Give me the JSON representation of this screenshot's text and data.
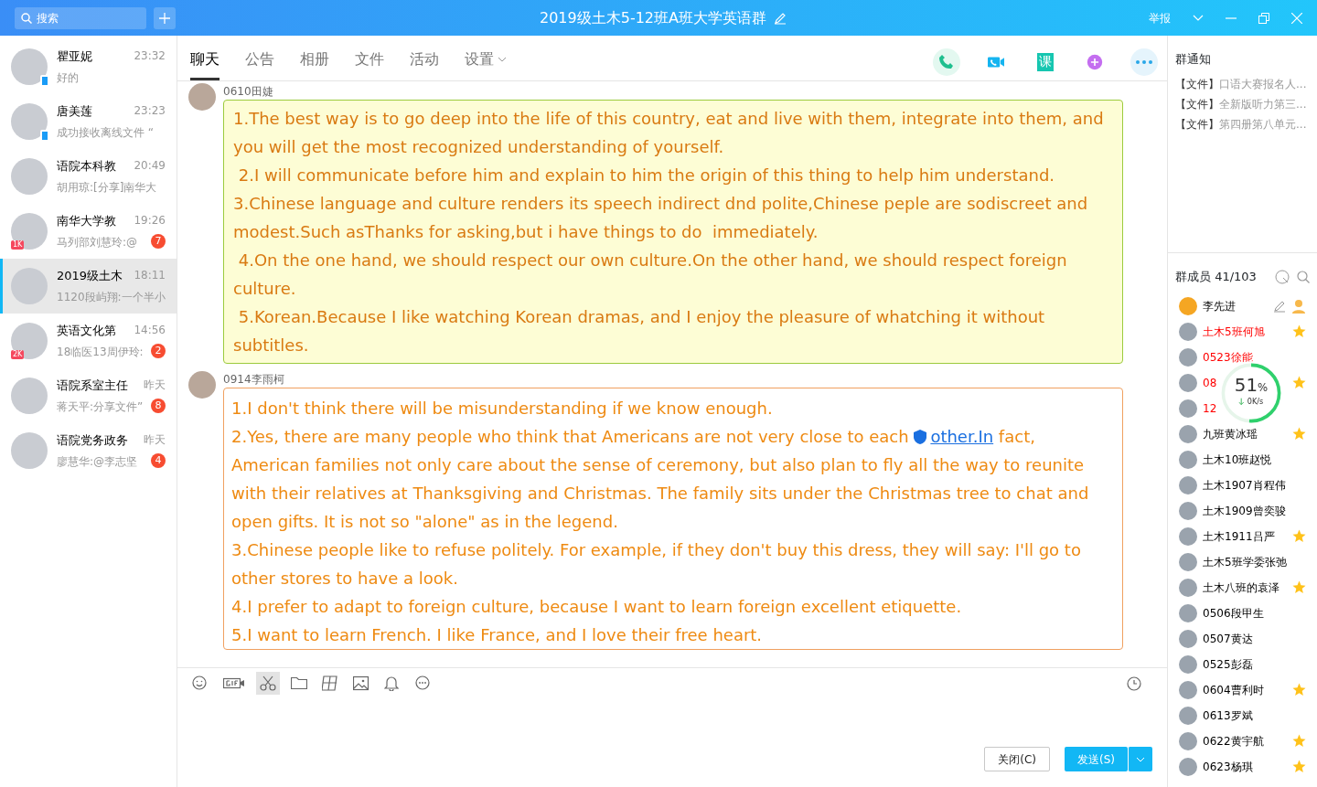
{
  "window": {
    "title": "2019级土木5-12班A班大学英语群",
    "report": "举报"
  },
  "search": {
    "placeholder": "搜索"
  },
  "contacts": [
    {
      "name": "瞿亚妮",
      "time": "23:32",
      "preview": "好的",
      "mobile": true,
      "selected": false
    },
    {
      "name": "唐美莲",
      "time": "23:23",
      "preview": "成功接收离线文件 “",
      "mobile": true,
      "selected": false
    },
    {
      "name": "语院本科教",
      "time": "20:49",
      "preview": "胡用琼:[分享]南华大",
      "mobile": false,
      "selected": false
    },
    {
      "name": "南华大学教",
      "time": "19:26",
      "preview": "马列部刘慧玲:@",
      "mobile": false,
      "selected": false,
      "tag": "1K",
      "unread": "7"
    },
    {
      "name": "2019级土木",
      "time": "18:11",
      "preview": "1120段屿翔:一个半小",
      "mobile": false,
      "selected": true
    },
    {
      "name": "英语文化第",
      "time": "14:56",
      "preview": "18临医13周伊玲:",
      "mobile": false,
      "selected": false,
      "tag": "2K",
      "unread": "2"
    },
    {
      "name": "语院系室主任",
      "time": "昨天",
      "preview": "蒋天平:分享文件”",
      "mobile": false,
      "selected": false,
      "unread": "8"
    },
    {
      "name": "语院党务政务",
      "time": "昨天",
      "preview": "廖慧华:@李志坚",
      "mobile": false,
      "selected": false,
      "unread": "4"
    }
  ],
  "tabs": [
    {
      "label": "聊天",
      "selected": true
    },
    {
      "label": "公告",
      "selected": false
    },
    {
      "label": "相册",
      "selected": false
    },
    {
      "label": "文件",
      "selected": false
    },
    {
      "label": "活动",
      "selected": false
    },
    {
      "label": "设置",
      "selected": false,
      "dropdown": true
    }
  ],
  "messages": [
    {
      "sender": "0610田婕",
      "kind": "note",
      "paragraphs": [
        {
          "text": "1.The best way is to go deep into the life of this country, eat and live with them, integrate into them, and you will get the most recognized understanding of yourself."
        },
        {
          "text": " 2.I will communicate before him and explain to him the origin of this thing to help him understand."
        },
        {
          "text": "3.Chinese language and culture renders its speech indirect dnd polite,Chinese peple are sodiscreet and modest.Such asThanks for asking,but i have things to do  immediately."
        },
        {
          "text": " 4.On the one hand, we should respect our own culture.On the other hand, we should respect foreign culture."
        },
        {
          "text": " 5.Korean.Because I like watching Korean dramas, and I enjoy the pleasure of whatching it without subtitles."
        }
      ]
    },
    {
      "sender": "0914李雨柯",
      "kind": "plain",
      "paragraphs": [
        {
          "text": "1.I don't think there will be misunderstanding if we know enough."
        },
        {
          "text": "2.Yes, there are many people who think that Americans are not very close to each ",
          "link": "other.In",
          "after": " fact, American families not only care about the sense of ceremony, but also plan to fly all the way to reunite with their relatives at Thanksgiving and Christmas. The family sits under the Christmas tree to chat and open gifts. It is not so \"alone\" as in the legend."
        },
        {
          "text": "3.Chinese people like to refuse politely. For example, if they don't buy this dress, they will say: I'll go to other stores to have a look."
        },
        {
          "text": "4.I prefer to adapt to foreign culture, because I want to learn foreign excellent etiquette."
        },
        {
          "text": "5.I want to learn French. I like France, and I love their free heart."
        }
      ]
    }
  ],
  "composer": {
    "close": "关闭(C)",
    "send": "发送(S)"
  },
  "actions": {
    "class_label": "课"
  },
  "notices": {
    "title": "群通知",
    "items": [
      {
        "tag": "【文件】",
        "text": "口语大赛报名人..."
      },
      {
        "tag": "【文件】",
        "text": "全新版听力第三..."
      },
      {
        "tag": "【文件】",
        "text": "第四册第八单元..."
      }
    ]
  },
  "members": {
    "title": "群成员 41/103",
    "items": [
      {
        "name": "李先进",
        "kind": "owner",
        "highlighted": false,
        "starred": false
      },
      {
        "name": "土木5班何旭",
        "kind": "member",
        "highlighted": true,
        "starred": true
      },
      {
        "name": "0523徐能",
        "kind": "member",
        "highlighted": true,
        "starred": false
      },
      {
        "name": "08",
        "kind": "member",
        "highlighted": true,
        "starred": true
      },
      {
        "name": "12",
        "kind": "member",
        "highlighted": true,
        "starred": false
      },
      {
        "name": "九班黄冰瑶",
        "kind": "member",
        "highlighted": false,
        "starred": true
      },
      {
        "name": "土木10班赵悦",
        "kind": "member",
        "highlighted": false,
        "starred": false
      },
      {
        "name": "土木1907肖程伟",
        "kind": "member",
        "highlighted": false,
        "starred": false
      },
      {
        "name": "土木1909曾奕骏",
        "kind": "member",
        "highlighted": false,
        "starred": false
      },
      {
        "name": "土木1911吕严",
        "kind": "member",
        "highlighted": false,
        "starred": true
      },
      {
        "name": "土木5班学委张弛",
        "kind": "member",
        "highlighted": false,
        "starred": false
      },
      {
        "name": "土木八班的袁泽",
        "kind": "member",
        "highlighted": false,
        "starred": true
      },
      {
        "name": "0506段甲生",
        "kind": "member",
        "highlighted": false,
        "starred": false
      },
      {
        "name": "0507黄达",
        "kind": "member",
        "highlighted": false,
        "starred": false
      },
      {
        "name": "0525彭磊",
        "kind": "member",
        "highlighted": false,
        "starred": false
      },
      {
        "name": "0604曹利时",
        "kind": "member",
        "highlighted": false,
        "starred": true
      },
      {
        "name": "0613罗斌",
        "kind": "member",
        "highlighted": false,
        "starred": false
      },
      {
        "name": "0622黄宇航",
        "kind": "member",
        "highlighted": false,
        "starred": true
      },
      {
        "name": "0623杨琪",
        "kind": "member",
        "highlighted": false,
        "starred": true
      }
    ]
  },
  "speed_widget": {
    "percent": "51",
    "unit": "%",
    "rate": "0K/s",
    "level": 0.51
  }
}
